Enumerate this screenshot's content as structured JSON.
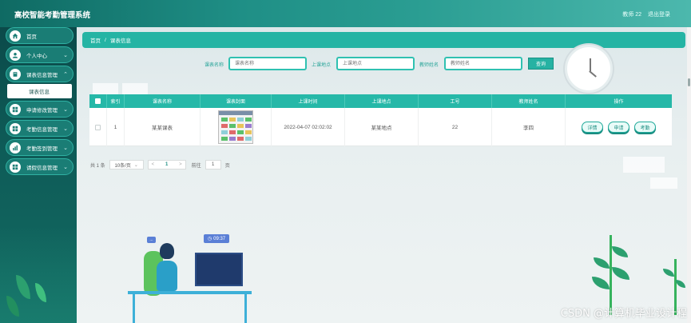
{
  "app": {
    "title": "高校智能考勤管理系统",
    "user": "教师 22",
    "logout": "退出登录"
  },
  "sidebar": {
    "items": [
      {
        "label": "首页",
        "icon": "home-icon",
        "has_chevron": false
      },
      {
        "label": "个人中心",
        "icon": "user-icon",
        "has_chevron": true
      },
      {
        "label": "课表信息管理",
        "icon": "book-icon",
        "has_chevron": true
      },
      {
        "label": "申请修改管理",
        "icon": "grid-icon",
        "has_chevron": true
      },
      {
        "label": "考勤信息管理",
        "icon": "grid-icon",
        "has_chevron": true
      },
      {
        "label": "考勤签到管理",
        "icon": "chart-icon",
        "has_chevron": true
      },
      {
        "label": "请假信息管理",
        "icon": "grid-icon",
        "has_chevron": true
      }
    ],
    "active_sub": "课表信息"
  },
  "breadcrumb": {
    "home": "首页",
    "separator": "/",
    "current": "课表信息"
  },
  "search": {
    "course_label": "课表名称",
    "course_placeholder": "课表名称",
    "location_label": "上课地点",
    "location_placeholder": "上课地点",
    "teacher_label": "教师姓名",
    "teacher_placeholder": "教师姓名",
    "button": "查询"
  },
  "table": {
    "headers": [
      "",
      "索引",
      "课表名称",
      "课表封面",
      "上课时间",
      "上课地点",
      "工号",
      "教师姓名",
      "操作"
    ],
    "rows": [
      {
        "index": "1",
        "name": "某某课表",
        "time": "2022-04-07 02:02:02",
        "location": "某某地点",
        "job_no": "22",
        "teacher": "李四",
        "actions": [
          "详情",
          "申请",
          "考勤"
        ]
      }
    ]
  },
  "pagination": {
    "total": "共 1 条",
    "page_size": "10条/页",
    "prev": "<",
    "page": "1",
    "next": ">",
    "goto_label": "前往",
    "goto_value": "1",
    "goto_suffix": "页"
  },
  "illustration": {
    "time": "09:37",
    "chat": "..."
  },
  "watermark": "CSDN @计算机毕业设计程",
  "colors": {
    "accent": "#26b8a8",
    "sidebar": "#0e5b57",
    "topbar": "#1f8f86"
  }
}
